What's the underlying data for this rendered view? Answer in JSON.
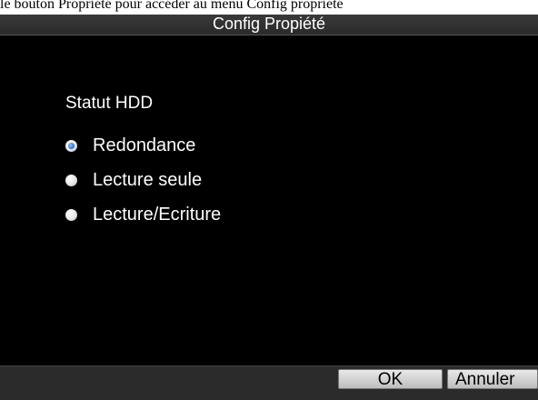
{
  "caption": "le bouton Propriété pour accéder au menu Config propriété",
  "dialog": {
    "title": "Config Propiété",
    "section_label": "Statut HDD",
    "options": [
      {
        "label": "Redondance",
        "checked": true
      },
      {
        "label": "Lecture seule",
        "checked": false
      },
      {
        "label": "Lecture/Ecriture",
        "checked": false
      }
    ],
    "buttons": {
      "ok": "OK",
      "cancel": "Annuler"
    }
  },
  "colors": {
    "background": "#000000",
    "titlebar": "#2e2e2e",
    "text": "#ffffff",
    "radio_selected": "#2e7ad6",
    "button_face": "#d4d4d4"
  }
}
